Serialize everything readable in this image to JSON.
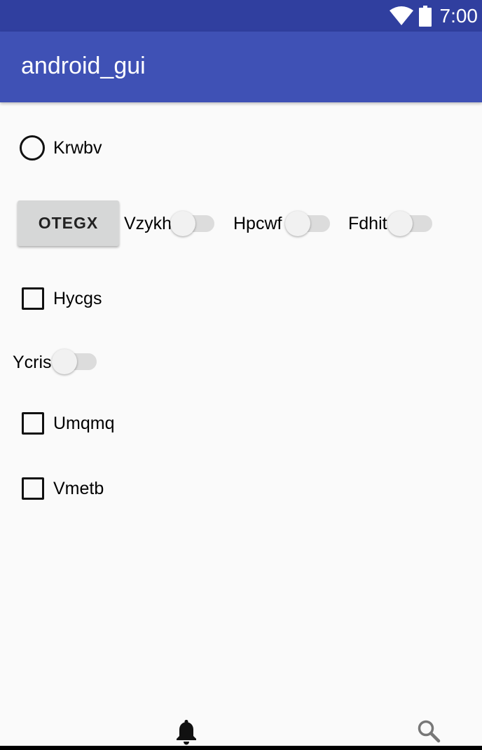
{
  "status_bar": {
    "time": "7:00",
    "icons": [
      "wifi-icon",
      "battery-icon"
    ]
  },
  "app_bar": {
    "title": "android_gui"
  },
  "content": {
    "radio": {
      "label": "Krwbv",
      "checked": false
    },
    "button": {
      "label": "OTEGX"
    },
    "switches_row": [
      {
        "label": "Vzykh",
        "on": false
      },
      {
        "label": "Hpcwf",
        "on": false
      },
      {
        "label": "Fdhit",
        "on": false
      }
    ],
    "checkbox_1": {
      "label": "Hycgs",
      "checked": false
    },
    "switch_single": {
      "label": "Ycris",
      "on": false
    },
    "checkbox_2": {
      "label": "Umqmq",
      "checked": false
    },
    "checkbox_3": {
      "label": "Vmetb",
      "checked": false
    }
  },
  "bottom_nav": {
    "icons": [
      "bell-icon",
      "search-icon"
    ]
  },
  "colors": {
    "status_bar": "#303f9f",
    "app_bar": "#3f51b5",
    "background": "#fafafa"
  }
}
